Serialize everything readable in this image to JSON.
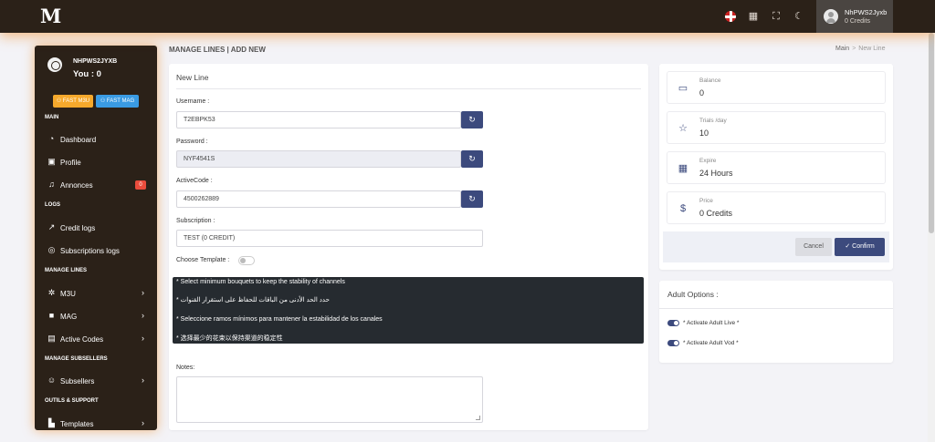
{
  "topbar": {
    "logo": "M",
    "user_name": "NhPWS2Jyxb",
    "user_credits": "0 Credits"
  },
  "sidebar": {
    "user_name": "NHPWS2JYXB",
    "you_label": "You : 0",
    "fast_m3u": "FAST M3U",
    "fast_mag": "FAST MAG",
    "sections": {
      "main": "MAIN",
      "logs": "LOGS",
      "manage_lines": "MANAGE LINES",
      "manage_subsellers": "MANAGE SUBSELLERS",
      "outils": "OUTILS & SUPPORT"
    },
    "items": {
      "dashboard": "Dashboard",
      "profile": "Profile",
      "annonces": "Annonces",
      "annonces_badge": "0",
      "credit_logs": "Credit logs",
      "subscriptions_logs": "Subscriptions logs",
      "m3u": "M3U",
      "mag": "MAG",
      "active_codes": "Active Codes",
      "subsellers": "Subsellers",
      "templates": "Templates"
    }
  },
  "header": {
    "title": "MANAGE LINES | ADD NEW",
    "breadcrumb_home": "Main",
    "breadcrumb_sep": ">",
    "breadcrumb_current": "New Line"
  },
  "form": {
    "title": "New Line",
    "username_label": "Username :",
    "username_value": "T2EBPK53",
    "password_label": "Password :",
    "password_value": "NYF4541S",
    "activecode_label": "ActiveCode :",
    "activecode_value": "4500262889",
    "subscription_label": "Subscription :",
    "subscription_value": "TEST (0 CREDIT)",
    "template_label": "Choose Template :",
    "notice": [
      "* Select minimum bouquets to keep the stability of channels",
      "* حدد الحد الأدنى من الباقات للحفاظ على استقرار القنوات",
      "* Seleccione ramos mínimos para mantener la estabilidad de los canales",
      "* 选择最少的花束以保持渠道的稳定性"
    ],
    "notes_label": "Notes:"
  },
  "stats": {
    "balance_label": "Balance",
    "balance_value": "0",
    "trials_label": "Trials /day",
    "trials_value": "10",
    "expire_label": "Expire",
    "expire_value": "24 Hours",
    "price_label": "Price",
    "price_value": "0 Credits",
    "cancel": "Cancel",
    "confirm": "Confirm"
  },
  "adult": {
    "title": "Adult Options :",
    "live_label": "* Activate Adult Live *",
    "live_on": true,
    "vod_label": "* Activate Adult Vod *",
    "vod_on": true
  },
  "colors": {
    "topbar": "#2b2118",
    "accent": "#3c4a7d",
    "glow": "#f08c28"
  }
}
